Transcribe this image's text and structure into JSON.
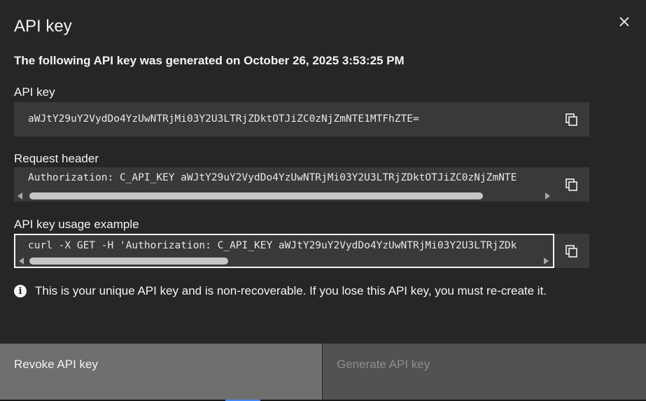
{
  "modal": {
    "title": "API key",
    "subtitle": "The following API key was generated on October 26, 2025 3:53:25 PM"
  },
  "fields": {
    "api_key": {
      "label": "API key",
      "value": "aWJtY29uY2VydDo4YzUwNTRjMi03Y2U3LTRjZDktOTJiZC0zNjZmNTE1MTFhZTE="
    },
    "request_header": {
      "label": "Request header",
      "value": "Authorization: C_API_KEY aWJtY29uY2VydDo4YzUwNTRjMi03Y2U3LTRjZDktOTJiZC0zNjZmNTE"
    },
    "usage_example": {
      "label": "API key usage example",
      "value": "curl -X GET -H 'Authorization: C_API_KEY aWJtY29uY2VydDo4YzUwNTRjMi03Y2U3LTRjZDk"
    }
  },
  "note": "This is your unique API key and is non-recoverable. If you lose this API key, you must re-create it.",
  "footer": {
    "revoke_label": "Revoke API key",
    "generate_label": "Generate API key"
  },
  "icons": {
    "close": "close-icon",
    "copy": "copy-icon",
    "info": "info-icon"
  }
}
